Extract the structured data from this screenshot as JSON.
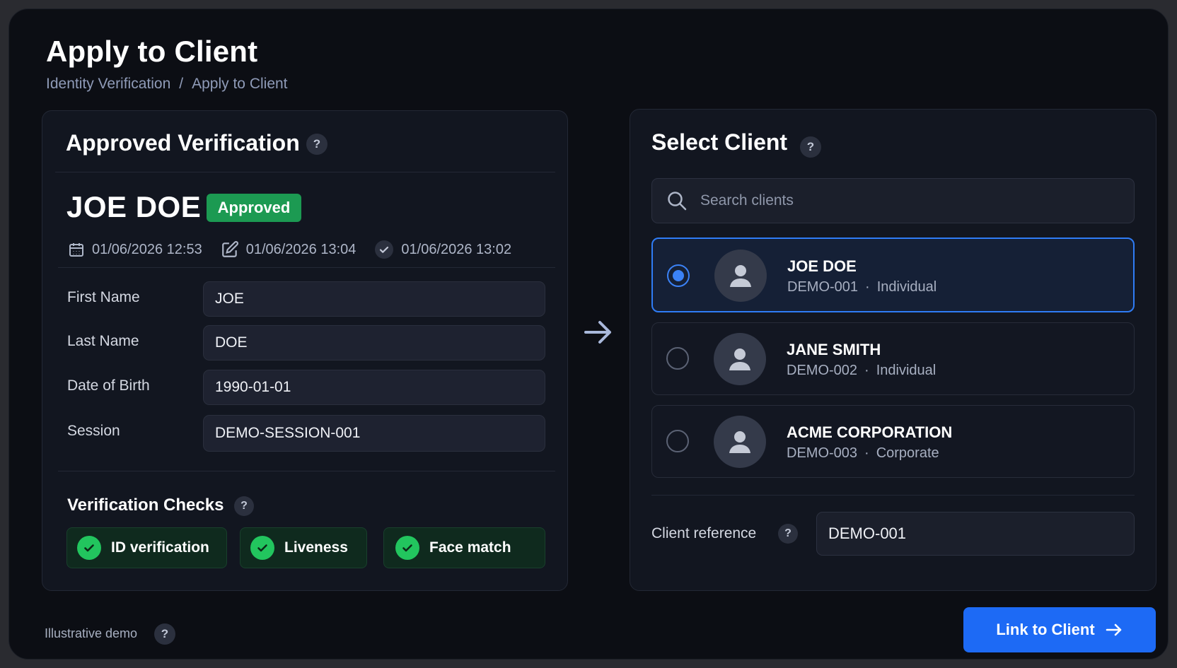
{
  "page": {
    "title": "Apply to Client",
    "breadcrumb": [
      "Identity Verification",
      "Apply to Client"
    ],
    "breadcrumb_separator": "/"
  },
  "verification": {
    "heading": "Approved Verification",
    "help": "?",
    "name": "JOE DOE",
    "status": "Approved",
    "created": "01/06/2026 12:53",
    "edited": "01/06/2026 13:04",
    "approved": "01/06/2026 13:02",
    "fields": [
      {
        "label": "First Name",
        "value": "JOE"
      },
      {
        "label": "Last Name",
        "value": "DOE"
      },
      {
        "label": "Date of Birth",
        "value": "1990-01-01"
      },
      {
        "label": "Session",
        "value": "DEMO-SESSION-001"
      }
    ],
    "checks_heading": "Verification Checks",
    "checks": [
      "ID verification",
      "Liveness",
      "Face match"
    ]
  },
  "clients": {
    "heading": "Select Client",
    "help": "?",
    "search_placeholder": "Search clients",
    "items": [
      {
        "name": "JOE DOE",
        "id": "DEMO-001",
        "type": "Individual",
        "selected": true
      },
      {
        "name": "JANE SMITH",
        "id": "DEMO-002",
        "type": "Individual",
        "selected": false
      },
      {
        "name": "ACME CORPORATION",
        "id": "DEMO-003",
        "type": "Corporate",
        "selected": false
      }
    ],
    "separator": "·",
    "reference_label": "Client reference",
    "reference_value": "DEMO-001"
  },
  "footer": {
    "note": "Illustrative demo",
    "help": "?",
    "link_button": "Link to Client"
  },
  "colors": {
    "accent": "#1d6af5",
    "approved": "#1c9a52",
    "check": "#22c55e"
  }
}
